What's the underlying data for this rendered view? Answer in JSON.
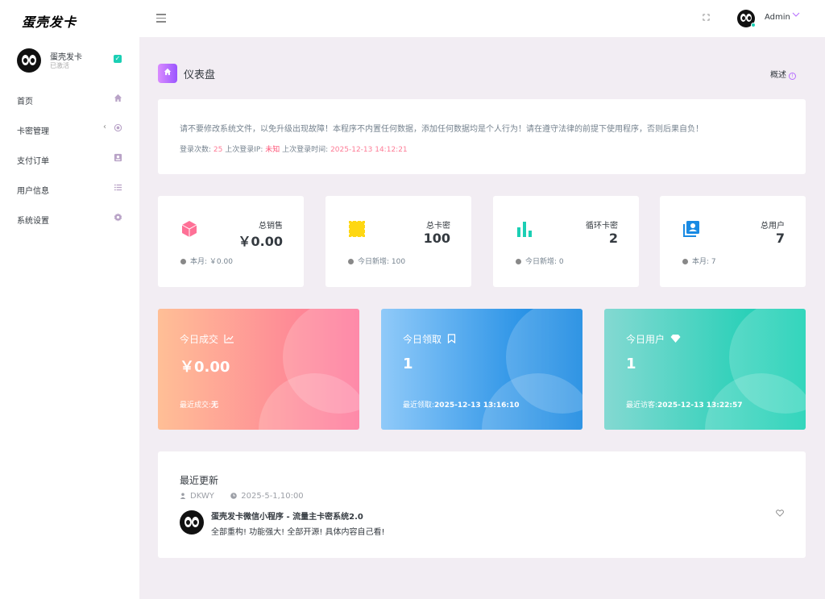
{
  "brand": "蛋壳发卡",
  "profile": {
    "name": "蛋壳发卡",
    "status": "已激活"
  },
  "nav": [
    {
      "label": "首页",
      "icon": "home-icon"
    },
    {
      "label": "卡密管理",
      "icon": "crosshair-icon"
    },
    {
      "label": "支付订单",
      "icon": "contact-card-icon"
    },
    {
      "label": "用户信息",
      "icon": "list-icon"
    },
    {
      "label": "系统设置",
      "icon": "gear-icon"
    }
  ],
  "topbar": {
    "user": "Admin"
  },
  "page": {
    "title": "仪表盘",
    "overview": "概述"
  },
  "notice": {
    "text": "请不要修改系统文件，以免升级出现故障！本程序不内置任何数据，添加任何数据均是个人行为！请在遵守法律的前提下使用程序，否则后果自负！",
    "login_count_label": "登录次数:",
    "login_count": "25",
    "last_ip_label": "上次登录IP:",
    "last_ip": "未知",
    "last_time_label": "上次登录时间:",
    "last_time": "2025-12-13 14:12:21"
  },
  "stats": [
    {
      "label": "总销售",
      "value": "￥0.00",
      "foot": "本月: ￥0.00",
      "color": "#fe7096"
    },
    {
      "label": "总卡密",
      "value": "100",
      "foot": "今日新增: 100",
      "color": "#fed713"
    },
    {
      "label": "循环卡密",
      "value": "2",
      "foot": "今日新增: 0",
      "color": "#1bcfb4"
    },
    {
      "label": "总用户",
      "value": "7",
      "foot": "本月: 7",
      "color": "#198ae3"
    }
  ],
  "cards": [
    {
      "title": "今日成交",
      "value": "￥0.00",
      "foot_label": "最近成交:",
      "foot_value": "无"
    },
    {
      "title": "今日领取",
      "value": "1",
      "foot_label": "最近领取:",
      "foot_value": "2025-12-13 13:16:10"
    },
    {
      "title": "今日用户",
      "value": "1",
      "foot_label": "最近访客:",
      "foot_value": "2025-12-13 13:22:57"
    }
  ],
  "updates": {
    "title": "最近更新",
    "author": "DKWY",
    "date": "2025-5-1,10:00",
    "headline": "蛋壳发卡微信小程序 - 流量主卡密系统2.0",
    "body": "全部重构! 功能强大! 全部开源! 具体内容自己看!"
  }
}
